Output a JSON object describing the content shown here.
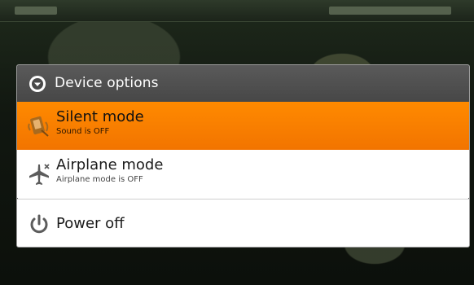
{
  "dialog": {
    "title": "Device options",
    "header_icon": "chevron-down-circle-icon",
    "items": [
      {
        "title": "Silent mode",
        "subtitle": "Sound is OFF",
        "icon": "silent-mode-icon",
        "selected": true
      },
      {
        "title": "Airplane mode",
        "subtitle": "Airplane mode is OFF",
        "icon": "airplane-icon",
        "selected": false
      },
      {
        "title": "Power off",
        "icon": "power-icon",
        "selected": false
      }
    ]
  },
  "colors": {
    "selected_row": "#f27400",
    "header_bg": "#474747",
    "dialog_bg": "#ffffff"
  }
}
